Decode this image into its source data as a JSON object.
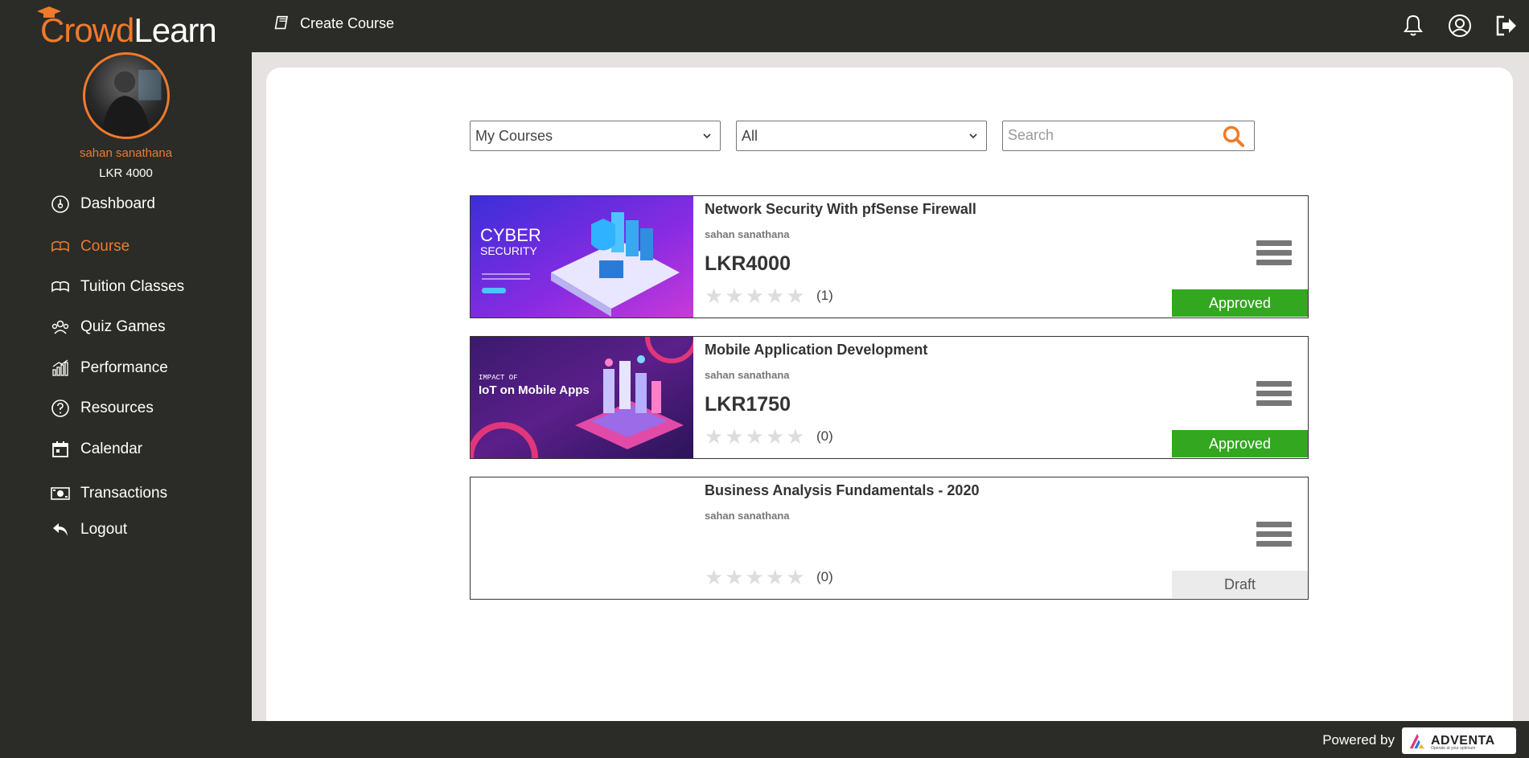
{
  "app": {
    "logo_part1": "Crowd",
    "logo_part2": "Learn"
  },
  "user": {
    "name": "sahan sanathana",
    "balance": "LKR 4000"
  },
  "sidebar": {
    "items": [
      {
        "label": "Dashboard",
        "icon": "dashboard-icon"
      },
      {
        "label": "Course",
        "icon": "book-icon",
        "active": true
      },
      {
        "label": "Tuition Classes",
        "icon": "book-open-icon"
      },
      {
        "label": "Quiz Games",
        "icon": "group-icon"
      },
      {
        "label": "Performance",
        "icon": "bar-chart-icon"
      },
      {
        "label": "Resources",
        "icon": "question-icon"
      },
      {
        "label": "Calendar",
        "icon": "calendar-icon"
      },
      {
        "label": "Transactions",
        "icon": "money-icon"
      },
      {
        "label": "Logout",
        "icon": "undo-icon"
      }
    ]
  },
  "topbar": {
    "create_course_label": "Create Course"
  },
  "filters": {
    "course_select": "My Courses",
    "status_select": "All",
    "search_placeholder": "Search"
  },
  "courses": [
    {
      "title": "Network Security With pfSense Firewall",
      "author": "sahan sanathana",
      "price": "LKR4000",
      "rating_count": "(1)",
      "status": "Approved",
      "thumb_text1": "CYBER",
      "thumb_text2": "SECURITY"
    },
    {
      "title": "Mobile Application Development",
      "author": "sahan sanathana",
      "price": "LKR1750",
      "rating_count": "(0)",
      "status": "Approved",
      "thumb_text1": "IMPACT OF",
      "thumb_text2": "IoT on Mobile Apps"
    },
    {
      "title": "Business Analysis Fundamentals - 2020",
      "author": "sahan sanathana",
      "price": "",
      "rating_count": "(0)",
      "status": "Draft"
    }
  ],
  "footer": {
    "powered_by": "Powered by",
    "brand": "ADVENTA",
    "brand_tagline": "Operate at your optimum"
  },
  "colors": {
    "accent": "#f07a2b",
    "sidebar_bg": "#2b2b27",
    "approved": "#33a720",
    "draft": "#ebebeb"
  }
}
